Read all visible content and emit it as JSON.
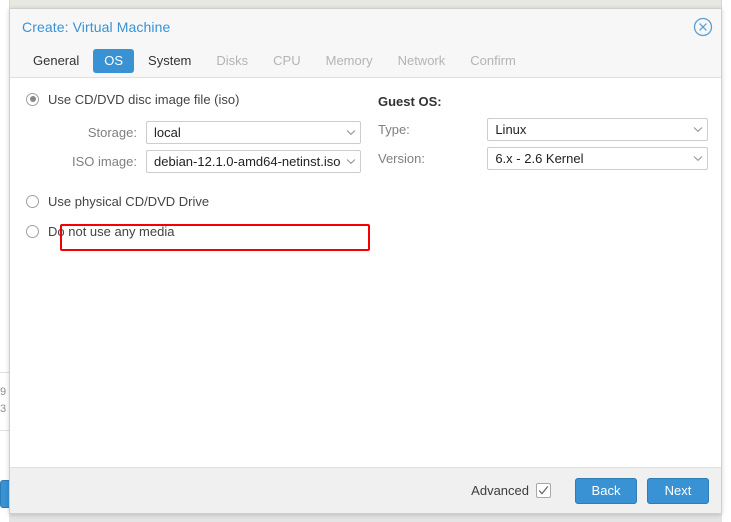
{
  "window": {
    "title": "Create: Virtual Machine",
    "close_icon": "close-circle-icon"
  },
  "tabs": [
    {
      "label": "General",
      "state": "enabled"
    },
    {
      "label": "OS",
      "state": "active"
    },
    {
      "label": "System",
      "state": "enabled"
    },
    {
      "label": "Disks",
      "state": "disabled"
    },
    {
      "label": "CPU",
      "state": "disabled"
    },
    {
      "label": "Memory",
      "state": "disabled"
    },
    {
      "label": "Network",
      "state": "disabled"
    },
    {
      "label": "Confirm",
      "state": "disabled"
    }
  ],
  "media": {
    "option_iso": "Use CD/DVD disc image file (iso)",
    "option_physical": "Use physical CD/DVD Drive",
    "option_none": "Do not use any media",
    "storage_label": "Storage:",
    "storage_value": "local",
    "iso_label": "ISO image:",
    "iso_value": "debian-12.1.0-amd64-netinst.iso"
  },
  "guest_os": {
    "heading": "Guest OS:",
    "type_label": "Type:",
    "type_value": "Linux",
    "version_label": "Version:",
    "version_value": "6.x - 2.6 Kernel"
  },
  "footer": {
    "advanced_label": "Advanced",
    "advanced_checked": true,
    "back_label": "Back",
    "next_label": "Next"
  },
  "backdrop": {
    "digit_top": "9",
    "digit_bottom": "3"
  },
  "colors": {
    "accent": "#3892d4",
    "title": "#3892d4",
    "highlight": "#f50000",
    "disabled_tab": "#b4b4b4",
    "label": "#808080"
  }
}
